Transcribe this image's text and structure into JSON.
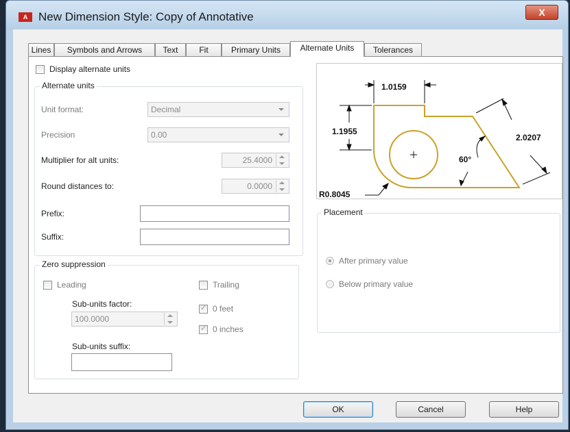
{
  "window": {
    "icon_text": "A",
    "title": "New Dimension Style: Copy of Annotative",
    "close_glyph": "X"
  },
  "tabs": [
    {
      "label": "Lines"
    },
    {
      "label": "Symbols and Arrows"
    },
    {
      "label": "Text"
    },
    {
      "label": "Fit"
    },
    {
      "label": "Primary Units"
    },
    {
      "label": "Alternate Units",
      "active": true
    },
    {
      "label": "Tolerances"
    }
  ],
  "display_alternate": {
    "label": "Display alternate units",
    "checked": false
  },
  "alternate_units": {
    "legend": "Alternate units",
    "unit_format_label": "Unit format:",
    "unit_format_value": "Decimal",
    "precision_label": "Precision",
    "precision_value": "0.00",
    "multiplier_label": "Multiplier for alt units:",
    "multiplier_value": "25.4000",
    "round_label": "Round distances to:",
    "round_value": "0.0000",
    "prefix_label": "Prefix:",
    "prefix_value": "",
    "suffix_label": "Suffix:",
    "suffix_value": ""
  },
  "zero_suppression": {
    "legend": "Zero suppression",
    "leading_label": "Leading",
    "trailing_label": "Trailing",
    "subunits_factor_label": "Sub-units factor:",
    "subunits_factor_value": "100.0000",
    "subunits_suffix_label": "Sub-units suffix:",
    "subunits_suffix_value": "",
    "feet_label": "0 feet",
    "inches_label": "0 inches",
    "feet_checked": true,
    "inches_checked": true
  },
  "preview": {
    "dim_top": "1.0159",
    "dim_left": "1.1955",
    "dim_right": "2.0207",
    "dim_angle": "60°",
    "dim_radius": "R0.8045",
    "line_color": "#c9a227"
  },
  "placement": {
    "legend": "Placement",
    "after_label": "After primary value",
    "below_label": "Below primary value",
    "selected": "after"
  },
  "buttons": {
    "ok": "OK",
    "cancel": "Cancel",
    "help": "Help"
  }
}
